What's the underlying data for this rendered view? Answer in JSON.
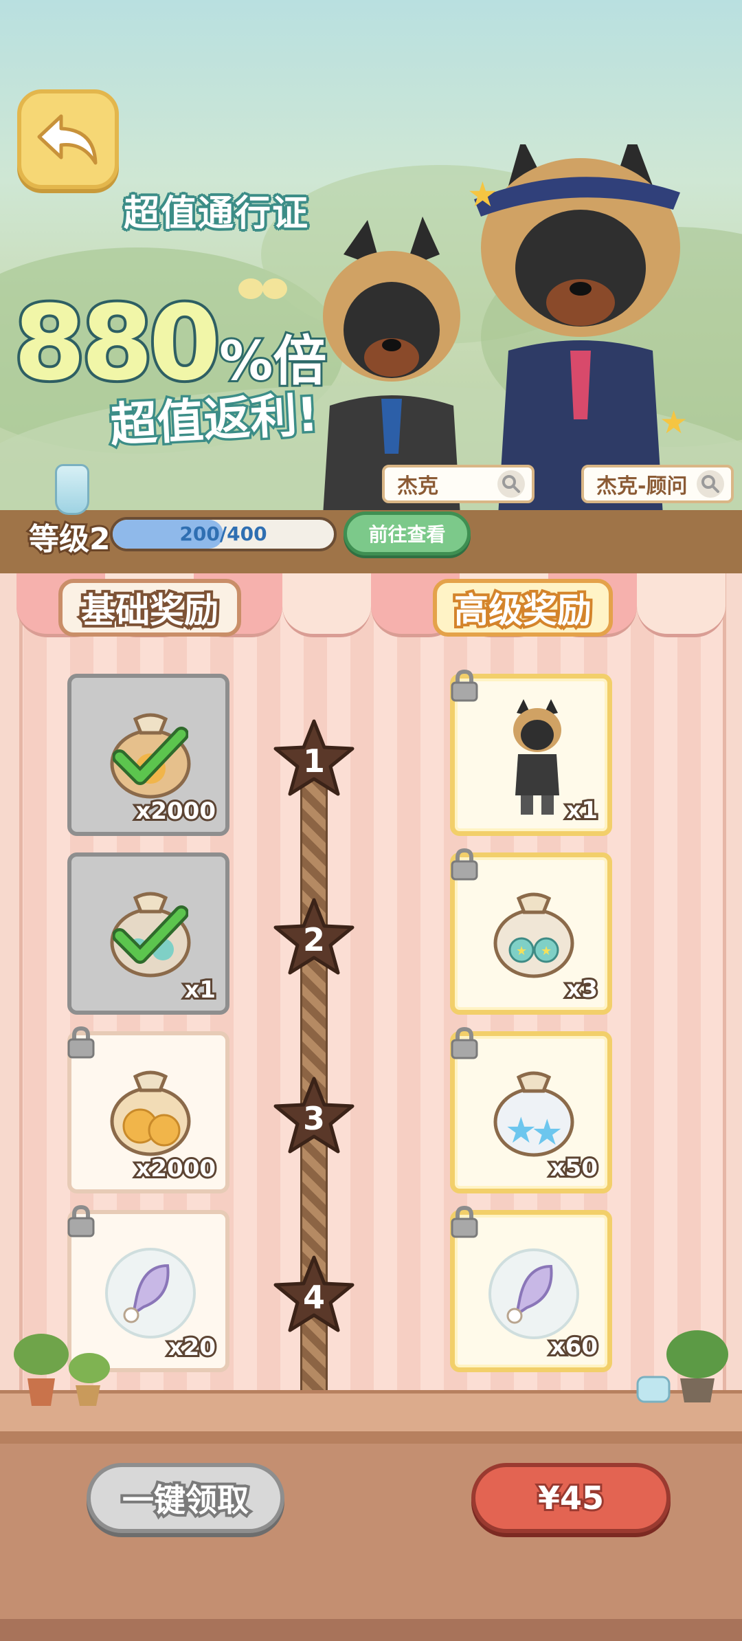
{
  "header": {
    "pass_title": "超值通行证",
    "promo_number": "880",
    "promo_suffix": "%倍",
    "promo_sub": "超值返利!",
    "characters": [
      {
        "name": "杰克"
      },
      {
        "name": "杰克-顾问"
      }
    ]
  },
  "level": {
    "label": "等级2",
    "exp_current": "200",
    "exp_separator": "/",
    "exp_max": "400",
    "exp_progress": 0.5,
    "view_button": "前往查看"
  },
  "tabs": {
    "basic": "基础奖励",
    "premium": "高级奖励"
  },
  "rewards": [
    {
      "tier": "1",
      "basic": {
        "qty": "x2000",
        "item": "coin-bag",
        "state": "claimed"
      },
      "premium": {
        "qty": "x1",
        "item": "character-outfit",
        "state": "locked"
      }
    },
    {
      "tier": "2",
      "basic": {
        "qty": "x1",
        "item": "medal-bag",
        "state": "claimed"
      },
      "premium": {
        "qty": "x3",
        "item": "medal-bag",
        "state": "locked"
      }
    },
    {
      "tier": "3",
      "basic": {
        "qty": "x2000",
        "item": "paw-coin-bag",
        "state": "locked"
      },
      "premium": {
        "qty": "x50",
        "item": "star-gem-bag",
        "state": "locked"
      }
    },
    {
      "tier": "4",
      "basic": {
        "qty": "x20",
        "item": "feather",
        "state": "locked"
      },
      "premium": {
        "qty": "x60",
        "item": "feather",
        "state": "locked"
      }
    }
  ],
  "footer": {
    "collect_all": "一键领取",
    "price": "¥45"
  },
  "colors": {
    "accent_green": "#7cc98a",
    "buy_red": "#e36452",
    "premium_gold": "#f2cf6a"
  }
}
